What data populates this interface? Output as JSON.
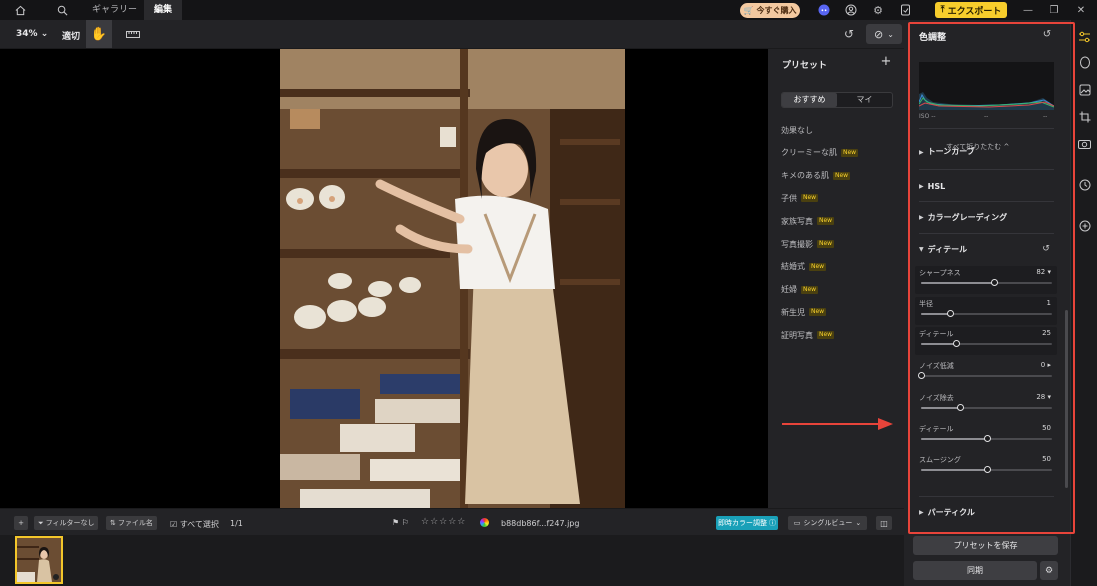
{
  "topbar": {
    "tabs": [
      {
        "label": "ギャラリー",
        "active": false
      },
      {
        "label": "編集",
        "active": true
      }
    ],
    "buy_label": "今すぐ購入",
    "export_label": "エクスポート",
    "icons": [
      "home-icon",
      "search-icon",
      "discord-icon",
      "account-icon",
      "settings-icon",
      "notification-icon",
      "minimize-icon",
      "restore-icon",
      "close-icon"
    ]
  },
  "toolbar": {
    "zoom": "34%",
    "fit_label": "適切",
    "icons": [
      "hand-icon",
      "ruler-icon",
      "reset-icon",
      "compare-icon"
    ]
  },
  "presets": {
    "title": "プリセット",
    "tabs": [
      {
        "label": "おすすめ",
        "active": true
      },
      {
        "label": "マイ",
        "active": false
      }
    ],
    "new_badge": "New",
    "items": [
      {
        "label": "効果なし",
        "new": false
      },
      {
        "label": "クリーミーな肌",
        "new": true
      },
      {
        "label": "キメのある肌",
        "new": true
      },
      {
        "label": "子供",
        "new": true
      },
      {
        "label": "家族写真",
        "new": true
      },
      {
        "label": "写真撮影",
        "new": true
      },
      {
        "label": "結婚式",
        "new": true
      },
      {
        "label": "妊婦",
        "new": true
      },
      {
        "label": "新生児",
        "new": true
      },
      {
        "label": "証明写真",
        "new": true
      }
    ]
  },
  "filmbar": {
    "filter_label": "フィルターなし",
    "sort_label": "ファイル名",
    "select_all_label": "すべて選択",
    "count": "1/1",
    "filename": "b88db86f...f247.jpg",
    "realtime_label": "即時カラー調整",
    "view_label": "シングルビュー",
    "rating_stars": "☆☆☆☆☆"
  },
  "adjust": {
    "title": "色調整",
    "iso_label": "ISO --",
    "histo_mid": "--",
    "histo_right": "--",
    "collapse_all": "すべて折りたたむ ^",
    "sections": {
      "tone": "トーンカーブ",
      "hsl": "HSL",
      "grading": "カラーグレーディング",
      "detail": "ディテール",
      "particle": "パーティクル"
    },
    "sliders": [
      {
        "label": "シャープネス",
        "value": "82 ▾",
        "pos": 0.56
      },
      {
        "label": "半径",
        "value": "1",
        "pos": 0.22
      },
      {
        "label": "ディテール",
        "value": "25",
        "pos": 0.27
      },
      {
        "label": "ノイズ低減",
        "value": "0 ▸",
        "pos": 0.0
      },
      {
        "label": "ノイズ除去",
        "value": "28 ▾",
        "pos": 0.3
      },
      {
        "label": "ディテール",
        "value": "50",
        "pos": 0.5
      },
      {
        "label": "スムージング",
        "value": "50",
        "pos": 0.5
      }
    ],
    "save_preset_label": "プリセットを保存",
    "sync_label": "同期"
  },
  "colors": {
    "accent": "#f3c62a",
    "export": "#f7cd2c",
    "realtime": "#19a0b8",
    "annotation": "#e8443a",
    "new_badge": "#f7d02c"
  }
}
